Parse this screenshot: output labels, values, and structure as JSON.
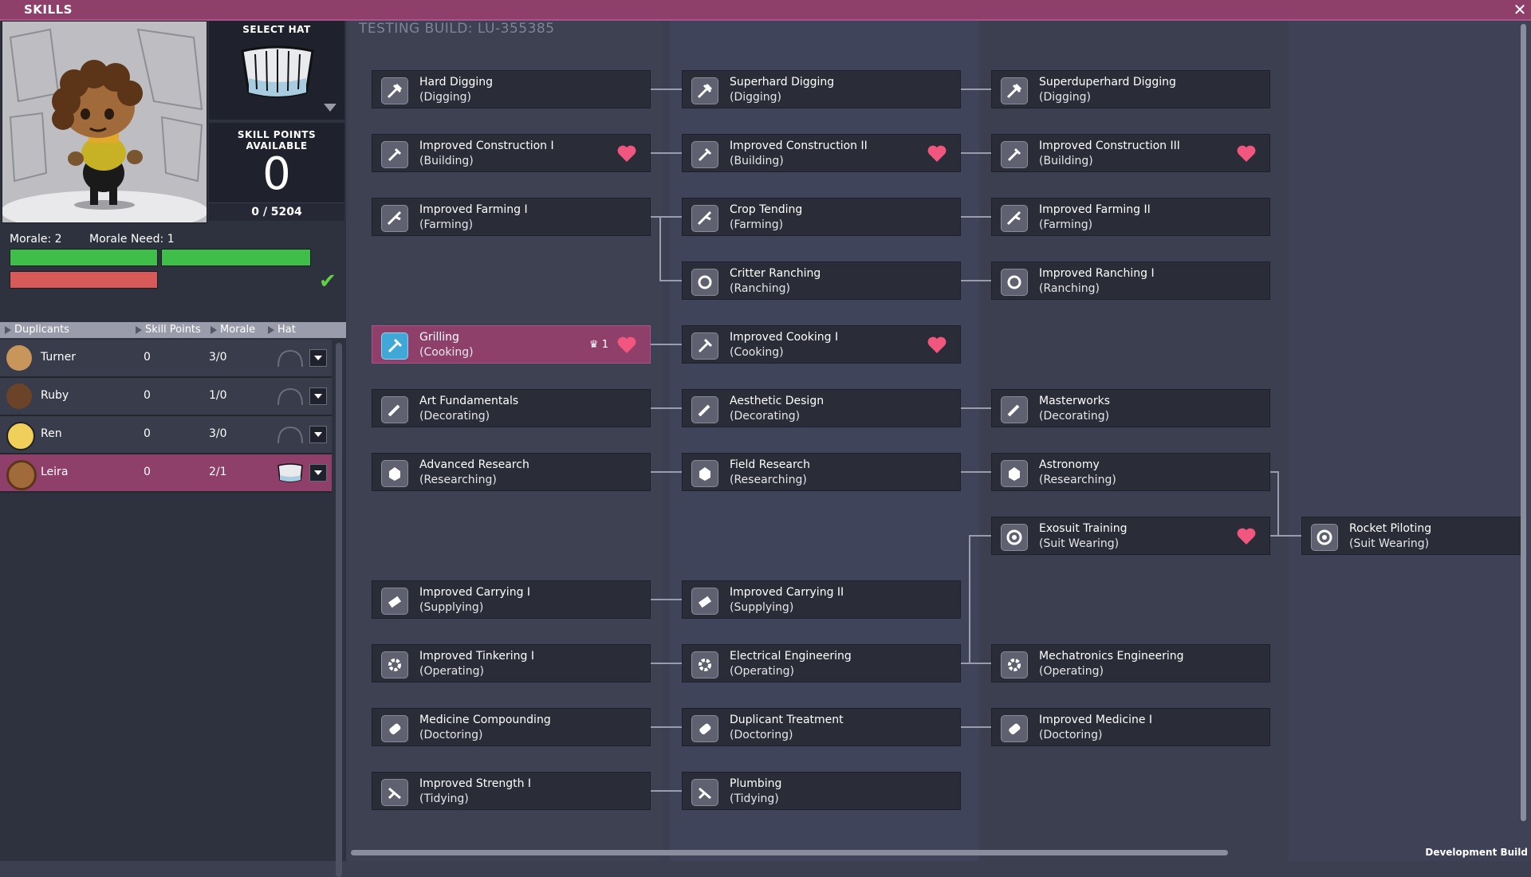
{
  "window": {
    "title": "SKILLS",
    "close_icon": "close-icon"
  },
  "hat": {
    "label": "SELECT HAT",
    "current_icon": "hat-icon"
  },
  "skill_points": {
    "label": "SKILL POINTS AVAILABLE",
    "value": "0",
    "xp": "0 / 5204"
  },
  "morale": {
    "morale_label": "Morale: 2",
    "need_label": "Morale Need: 1",
    "status_icon": "checkmark-icon"
  },
  "list_header": {
    "duplicants": "Duplicants",
    "skill_points": "Skill Points",
    "morale": "Morale",
    "hat": "Hat"
  },
  "duplicants": [
    {
      "name": "Turner",
      "points": "0",
      "morale": "3/0"
    },
    {
      "name": "Ruby",
      "points": "0",
      "morale": "1/0"
    },
    {
      "name": "Ren",
      "points": "0",
      "morale": "3/0"
    },
    {
      "name": "Leira",
      "points": "0",
      "morale": "2/1"
    }
  ],
  "build_label": "TESTING BUILD: LU-355385",
  "dev_build": "Development Build",
  "skills": [
    {
      "name": "Hard Digging",
      "group": "(Digging)"
    },
    {
      "name": "Superhard Digging",
      "group": "(Digging)"
    },
    {
      "name": "Superduperhard Digging",
      "group": "(Digging)"
    },
    {
      "name": "Improved Construction I",
      "group": "(Building)"
    },
    {
      "name": "Improved Construction II",
      "group": "(Building)"
    },
    {
      "name": "Improved Construction III",
      "group": "(Building)"
    },
    {
      "name": "Improved Farming I",
      "group": "(Farming)"
    },
    {
      "name": "Crop Tending",
      "group": "(Farming)"
    },
    {
      "name": "Improved Farming II",
      "group": "(Farming)"
    },
    {
      "name": "Critter Ranching",
      "group": "(Ranching)"
    },
    {
      "name": "Improved Ranching I",
      "group": "(Ranching)"
    },
    {
      "name": "Grilling",
      "group": "(Cooking)",
      "mastery": "1"
    },
    {
      "name": "Improved Cooking I",
      "group": "(Cooking)"
    },
    {
      "name": "Art Fundamentals",
      "group": "(Decorating)"
    },
    {
      "name": "Aesthetic Design",
      "group": "(Decorating)"
    },
    {
      "name": "Masterworks",
      "group": "(Decorating)"
    },
    {
      "name": "Advanced Research",
      "group": "(Researching)"
    },
    {
      "name": "Field Research",
      "group": "(Researching)"
    },
    {
      "name": "Astronomy",
      "group": "(Researching)"
    },
    {
      "name": "Exosuit Training",
      "group": "(Suit Wearing)"
    },
    {
      "name": "Rocket Piloting",
      "group": "(Suit Wearing)"
    },
    {
      "name": "Improved Carrying I",
      "group": "(Supplying)"
    },
    {
      "name": "Improved Carrying II",
      "group": "(Supplying)"
    },
    {
      "name": "Improved Tinkering I",
      "group": "(Operating)"
    },
    {
      "name": "Electrical Engineering",
      "group": "(Operating)"
    },
    {
      "name": "Mechatronics Engineering",
      "group": "(Operating)"
    },
    {
      "name": "Medicine Compounding",
      "group": "(Doctoring)"
    },
    {
      "name": "Duplicant Treatment",
      "group": "(Doctoring)"
    },
    {
      "name": "Improved Medicine I",
      "group": "(Doctoring)"
    },
    {
      "name": "Improved Strength I",
      "group": "(Tidying)"
    },
    {
      "name": "Plumbing",
      "group": "(Tidying)"
    }
  ],
  "colors": {
    "accent": "#8e3f6a",
    "heart": "#f0567e",
    "morale_good": "#3fbf4a",
    "morale_need": "#d85a58"
  }
}
